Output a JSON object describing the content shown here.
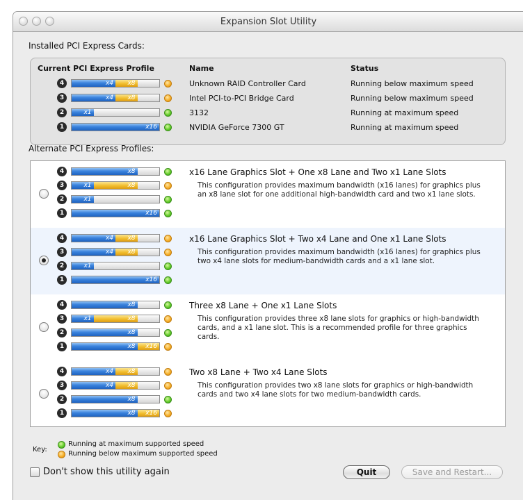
{
  "window": {
    "title": "Expansion Slot Utility"
  },
  "colors": {
    "blue_lane": "#3a83dd",
    "yellow_lane": "#f1bd2d",
    "status_green": "#66cd2c",
    "status_orange": "#f6b02a",
    "selected_row": "#eef4fd"
  },
  "installed": {
    "label": "Installed PCI Express Cards:",
    "headers": {
      "profile": "Current PCI Express Profile",
      "name": "Name",
      "status": "Status"
    },
    "rows": [
      {
        "slot": "4",
        "lanes": [
          {
            "label": "x4",
            "color": "blue",
            "fraction": 0.5
          },
          {
            "label": "x8",
            "color": "yellow",
            "fraction": 0.25
          }
        ],
        "indicator": "orange",
        "name": "Unknown RAID Controller Card",
        "status": "Running below maximum speed"
      },
      {
        "slot": "3",
        "lanes": [
          {
            "label": "x4",
            "color": "blue",
            "fraction": 0.5
          },
          {
            "label": "x8",
            "color": "yellow",
            "fraction": 0.25
          }
        ],
        "indicator": "orange",
        "name": "Intel PCI-to-PCI Bridge Card",
        "status": "Running below maximum speed"
      },
      {
        "slot": "2",
        "lanes": [
          {
            "label": "x1",
            "color": "blue",
            "fraction": 0.25
          }
        ],
        "indicator": "green",
        "name": "3132",
        "status": "Running at maximum speed"
      },
      {
        "slot": "1",
        "lanes": [
          {
            "label": "x16",
            "color": "blue",
            "fraction": 1.0
          }
        ],
        "indicator": "green",
        "name": "NVIDIA GeForce 7300 GT",
        "status": "Running at maximum speed"
      }
    ]
  },
  "alternates": {
    "label": "Alternate PCI Express Profiles:",
    "profiles": [
      {
        "title": "x16 Lane Graphics Slot + One x8 Lane and Two x1 Lane Slots",
        "description": "This configuration provides maximum bandwidth (x16 lanes) for graphics plus an x8 lane slot for one additional high-bandwidth card and two x1 lane slots.",
        "selected": false,
        "slots": [
          {
            "slot": "4",
            "lanes": [
              {
                "label": "x8",
                "color": "blue",
                "fraction": 0.75
              }
            ],
            "indicator": "green"
          },
          {
            "slot": "3",
            "lanes": [
              {
                "label": "x1",
                "color": "blue",
                "fraction": 0.25
              },
              {
                "label": "x8",
                "color": "yellow",
                "fraction": 0.5
              }
            ],
            "indicator": "orange"
          },
          {
            "slot": "2",
            "lanes": [
              {
                "label": "x1",
                "color": "blue",
                "fraction": 0.25
              }
            ],
            "indicator": "green"
          },
          {
            "slot": "1",
            "lanes": [
              {
                "label": "x16",
                "color": "blue",
                "fraction": 1.0
              }
            ],
            "indicator": "green"
          }
        ]
      },
      {
        "title": "x16 Lane Graphics Slot + Two x4 Lane and One x1 Lane Slots",
        "description": "This configuration provides maximum bandwidth (x16 lanes) for graphics plus two x4 lane slots for medium-bandwidth cards and a x1 lane slot.",
        "selected": true,
        "slots": [
          {
            "slot": "4",
            "lanes": [
              {
                "label": "x4",
                "color": "blue",
                "fraction": 0.5
              },
              {
                "label": "x8",
                "color": "yellow",
                "fraction": 0.25
              }
            ],
            "indicator": "orange"
          },
          {
            "slot": "3",
            "lanes": [
              {
                "label": "x4",
                "color": "blue",
                "fraction": 0.5
              },
              {
                "label": "x8",
                "color": "yellow",
                "fraction": 0.25
              }
            ],
            "indicator": "orange"
          },
          {
            "slot": "2",
            "lanes": [
              {
                "label": "x1",
                "color": "blue",
                "fraction": 0.25
              }
            ],
            "indicator": "green"
          },
          {
            "slot": "1",
            "lanes": [
              {
                "label": "x16",
                "color": "blue",
                "fraction": 1.0
              }
            ],
            "indicator": "green"
          }
        ]
      },
      {
        "title": "Three x8 Lane + One x1 Lane Slots",
        "description": "This configuration provides three x8 lane slots for graphics or high-bandwidth cards, and a x1 lane slot.  This is a recommended profile for three graphics cards.",
        "selected": false,
        "slots": [
          {
            "slot": "4",
            "lanes": [
              {
                "label": "x8",
                "color": "blue",
                "fraction": 0.75
              }
            ],
            "indicator": "green"
          },
          {
            "slot": "3",
            "lanes": [
              {
                "label": "x1",
                "color": "blue",
                "fraction": 0.25
              },
              {
                "label": "x8",
                "color": "yellow",
                "fraction": 0.5
              }
            ],
            "indicator": "orange"
          },
          {
            "slot": "2",
            "lanes": [
              {
                "label": "x8",
                "color": "blue",
                "fraction": 0.75
              }
            ],
            "indicator": "green"
          },
          {
            "slot": "1",
            "lanes": [
              {
                "label": "x8",
                "color": "blue",
                "fraction": 0.75
              },
              {
                "label": "x16",
                "color": "yellow",
                "fraction": 0.25
              }
            ],
            "indicator": "orange"
          }
        ]
      },
      {
        "title": "Two x8 Lane + Two x4 Lane Slots",
        "description": "This configuration provides two x8 lane slots for graphics or high-bandwidth cards and two x4 lane slots for two medium-bandwidth cards.",
        "selected": false,
        "slots": [
          {
            "slot": "4",
            "lanes": [
              {
                "label": "x4",
                "color": "blue",
                "fraction": 0.5
              },
              {
                "label": "x8",
                "color": "yellow",
                "fraction": 0.25
              }
            ],
            "indicator": "orange"
          },
          {
            "slot": "3",
            "lanes": [
              {
                "label": "x4",
                "color": "blue",
                "fraction": 0.5
              },
              {
                "label": "x8",
                "color": "yellow",
                "fraction": 0.25
              }
            ],
            "indicator": "orange"
          },
          {
            "slot": "2",
            "lanes": [
              {
                "label": "x8",
                "color": "blue",
                "fraction": 0.75
              }
            ],
            "indicator": "green"
          },
          {
            "slot": "1",
            "lanes": [
              {
                "label": "x8",
                "color": "blue",
                "fraction": 0.75
              },
              {
                "label": "x16",
                "color": "yellow",
                "fraction": 0.25
              }
            ],
            "indicator": "orange"
          }
        ]
      }
    ]
  },
  "key": {
    "label": "Key:",
    "green": "Running at maximum supported speed",
    "orange": "Running below maximum supported speed"
  },
  "footer": {
    "checkbox_label": "Don't show this utility again",
    "quit_label": "Quit",
    "save_label": "Save and Restart..."
  }
}
